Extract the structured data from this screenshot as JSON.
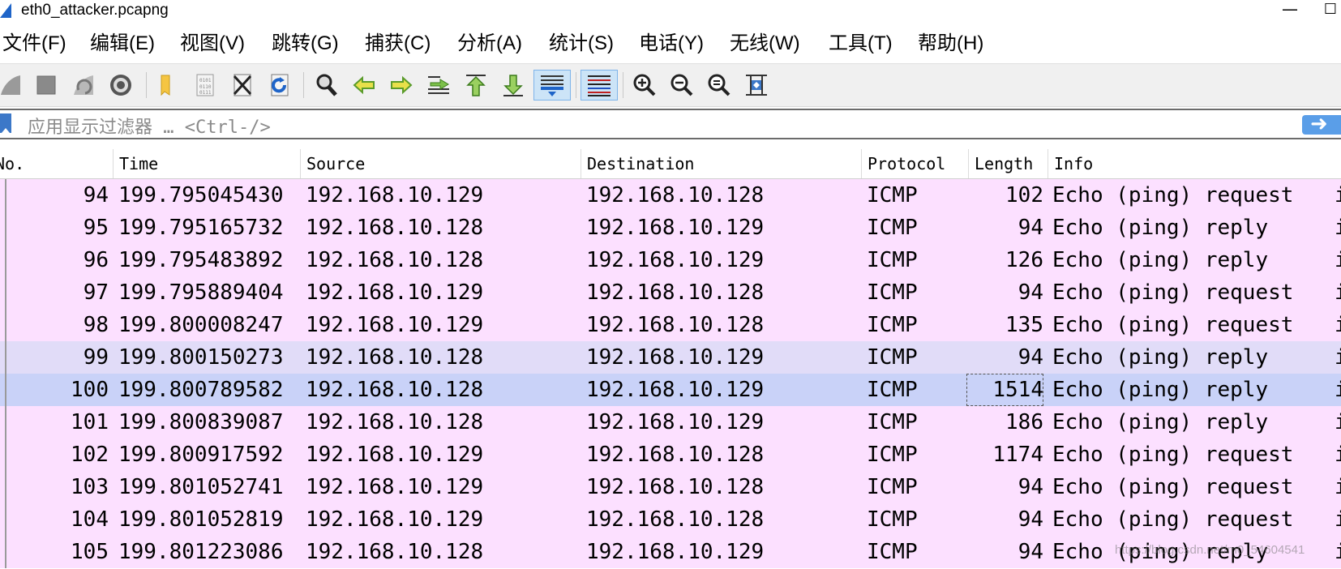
{
  "window": {
    "title": "eth0_attacker.pcapng",
    "minimize": "—",
    "maximize": "☐"
  },
  "menu": [
    {
      "label": "文件(F)"
    },
    {
      "label": "编辑(E)"
    },
    {
      "label": "视图(V)"
    },
    {
      "label": "跳转(G)"
    },
    {
      "label": "捕获(C)"
    },
    {
      "label": "分析(A)"
    },
    {
      "label": "统计(S)"
    },
    {
      "label": "电话(Y)"
    },
    {
      "label": "无线(W)"
    },
    {
      "label": "工具(T)"
    },
    {
      "label": "帮助(H)"
    }
  ],
  "toolbar": {
    "icons": [
      "start-capture-icon",
      "stop-capture-icon",
      "restart-capture-icon",
      "capture-options-icon",
      "open-file-icon",
      "save-file-icon",
      "close-file-icon",
      "reload-file-icon",
      "find-packet-icon",
      "go-back-icon",
      "go-forward-icon",
      "go-to-packet-icon",
      "go-first-icon",
      "go-last-icon",
      "autoscroll-icon",
      "colorize-icon",
      "zoom-in-icon",
      "zoom-out-icon",
      "zoom-normal-icon",
      "resize-columns-icon"
    ]
  },
  "filter": {
    "placeholder": "应用显示过滤器 … <Ctrl-/>",
    "value": ""
  },
  "packet_list": {
    "columns": [
      "No.",
      "Time",
      "Source",
      "Destination",
      "Protocol",
      "Length",
      "Info"
    ],
    "rows": [
      {
        "no": "94",
        "time": "199.795045430",
        "source": "192.168.10.129",
        "destination": "192.168.10.128",
        "protocol": "ICMP",
        "length": "102",
        "info": "Echo (ping) request",
        "tail": "i",
        "style": "pink"
      },
      {
        "no": "95",
        "time": "199.795165732",
        "source": "192.168.10.128",
        "destination": "192.168.10.129",
        "protocol": "ICMP",
        "length": "94",
        "info": "Echo (ping) reply",
        "tail": "i",
        "style": "pink"
      },
      {
        "no": "96",
        "time": "199.795483892",
        "source": "192.168.10.128",
        "destination": "192.168.10.129",
        "protocol": "ICMP",
        "length": "126",
        "info": "Echo (ping) reply",
        "tail": "i",
        "style": "pink"
      },
      {
        "no": "97",
        "time": "199.795889404",
        "source": "192.168.10.129",
        "destination": "192.168.10.128",
        "protocol": "ICMP",
        "length": "94",
        "info": "Echo (ping) request",
        "tail": "i",
        "style": "pink"
      },
      {
        "no": "98",
        "time": "199.800008247",
        "source": "192.168.10.129",
        "destination": "192.168.10.128",
        "protocol": "ICMP",
        "length": "135",
        "info": "Echo (ping) request",
        "tail": "i",
        "style": "pink"
      },
      {
        "no": "99",
        "time": "199.800150273",
        "source": "192.168.10.128",
        "destination": "192.168.10.129",
        "protocol": "ICMP",
        "length": "94",
        "info": "Echo (ping) reply",
        "tail": "i",
        "style": "alt"
      },
      {
        "no": "100",
        "time": "199.800789582",
        "source": "192.168.10.128",
        "destination": "192.168.10.129",
        "protocol": "ICMP",
        "length": "1514",
        "info": "Echo (ping) reply",
        "tail": "i",
        "style": "selected"
      },
      {
        "no": "101",
        "time": "199.800839087",
        "source": "192.168.10.128",
        "destination": "192.168.10.129",
        "protocol": "ICMP",
        "length": "186",
        "info": "Echo (ping) reply",
        "tail": "i",
        "style": "pink"
      },
      {
        "no": "102",
        "time": "199.800917592",
        "source": "192.168.10.129",
        "destination": "192.168.10.128",
        "protocol": "ICMP",
        "length": "1174",
        "info": "Echo (ping) request",
        "tail": "i",
        "style": "pink"
      },
      {
        "no": "103",
        "time": "199.801052741",
        "source": "192.168.10.129",
        "destination": "192.168.10.128",
        "protocol": "ICMP",
        "length": "94",
        "info": "Echo (ping) request",
        "tail": "i",
        "style": "pink"
      },
      {
        "no": "104",
        "time": "199.801052819",
        "source": "192.168.10.129",
        "destination": "192.168.10.128",
        "protocol": "ICMP",
        "length": "94",
        "info": "Echo (ping) request",
        "tail": "i",
        "style": "pink"
      },
      {
        "no": "105",
        "time": "199.801223086",
        "source": "192.168.10.128",
        "destination": "192.168.10.129",
        "protocol": "ICMP",
        "length": "94",
        "info": "Echo (ping) reply",
        "tail": "i",
        "style": "pink"
      }
    ]
  },
  "watermark": "https://blog.csdn.net/m0_54604541",
  "colors": {
    "row_pink": "#fce0ff",
    "row_alt": "#e1dcf8",
    "row_selected": "#c9d2f8",
    "accent": "#3c78c8"
  }
}
